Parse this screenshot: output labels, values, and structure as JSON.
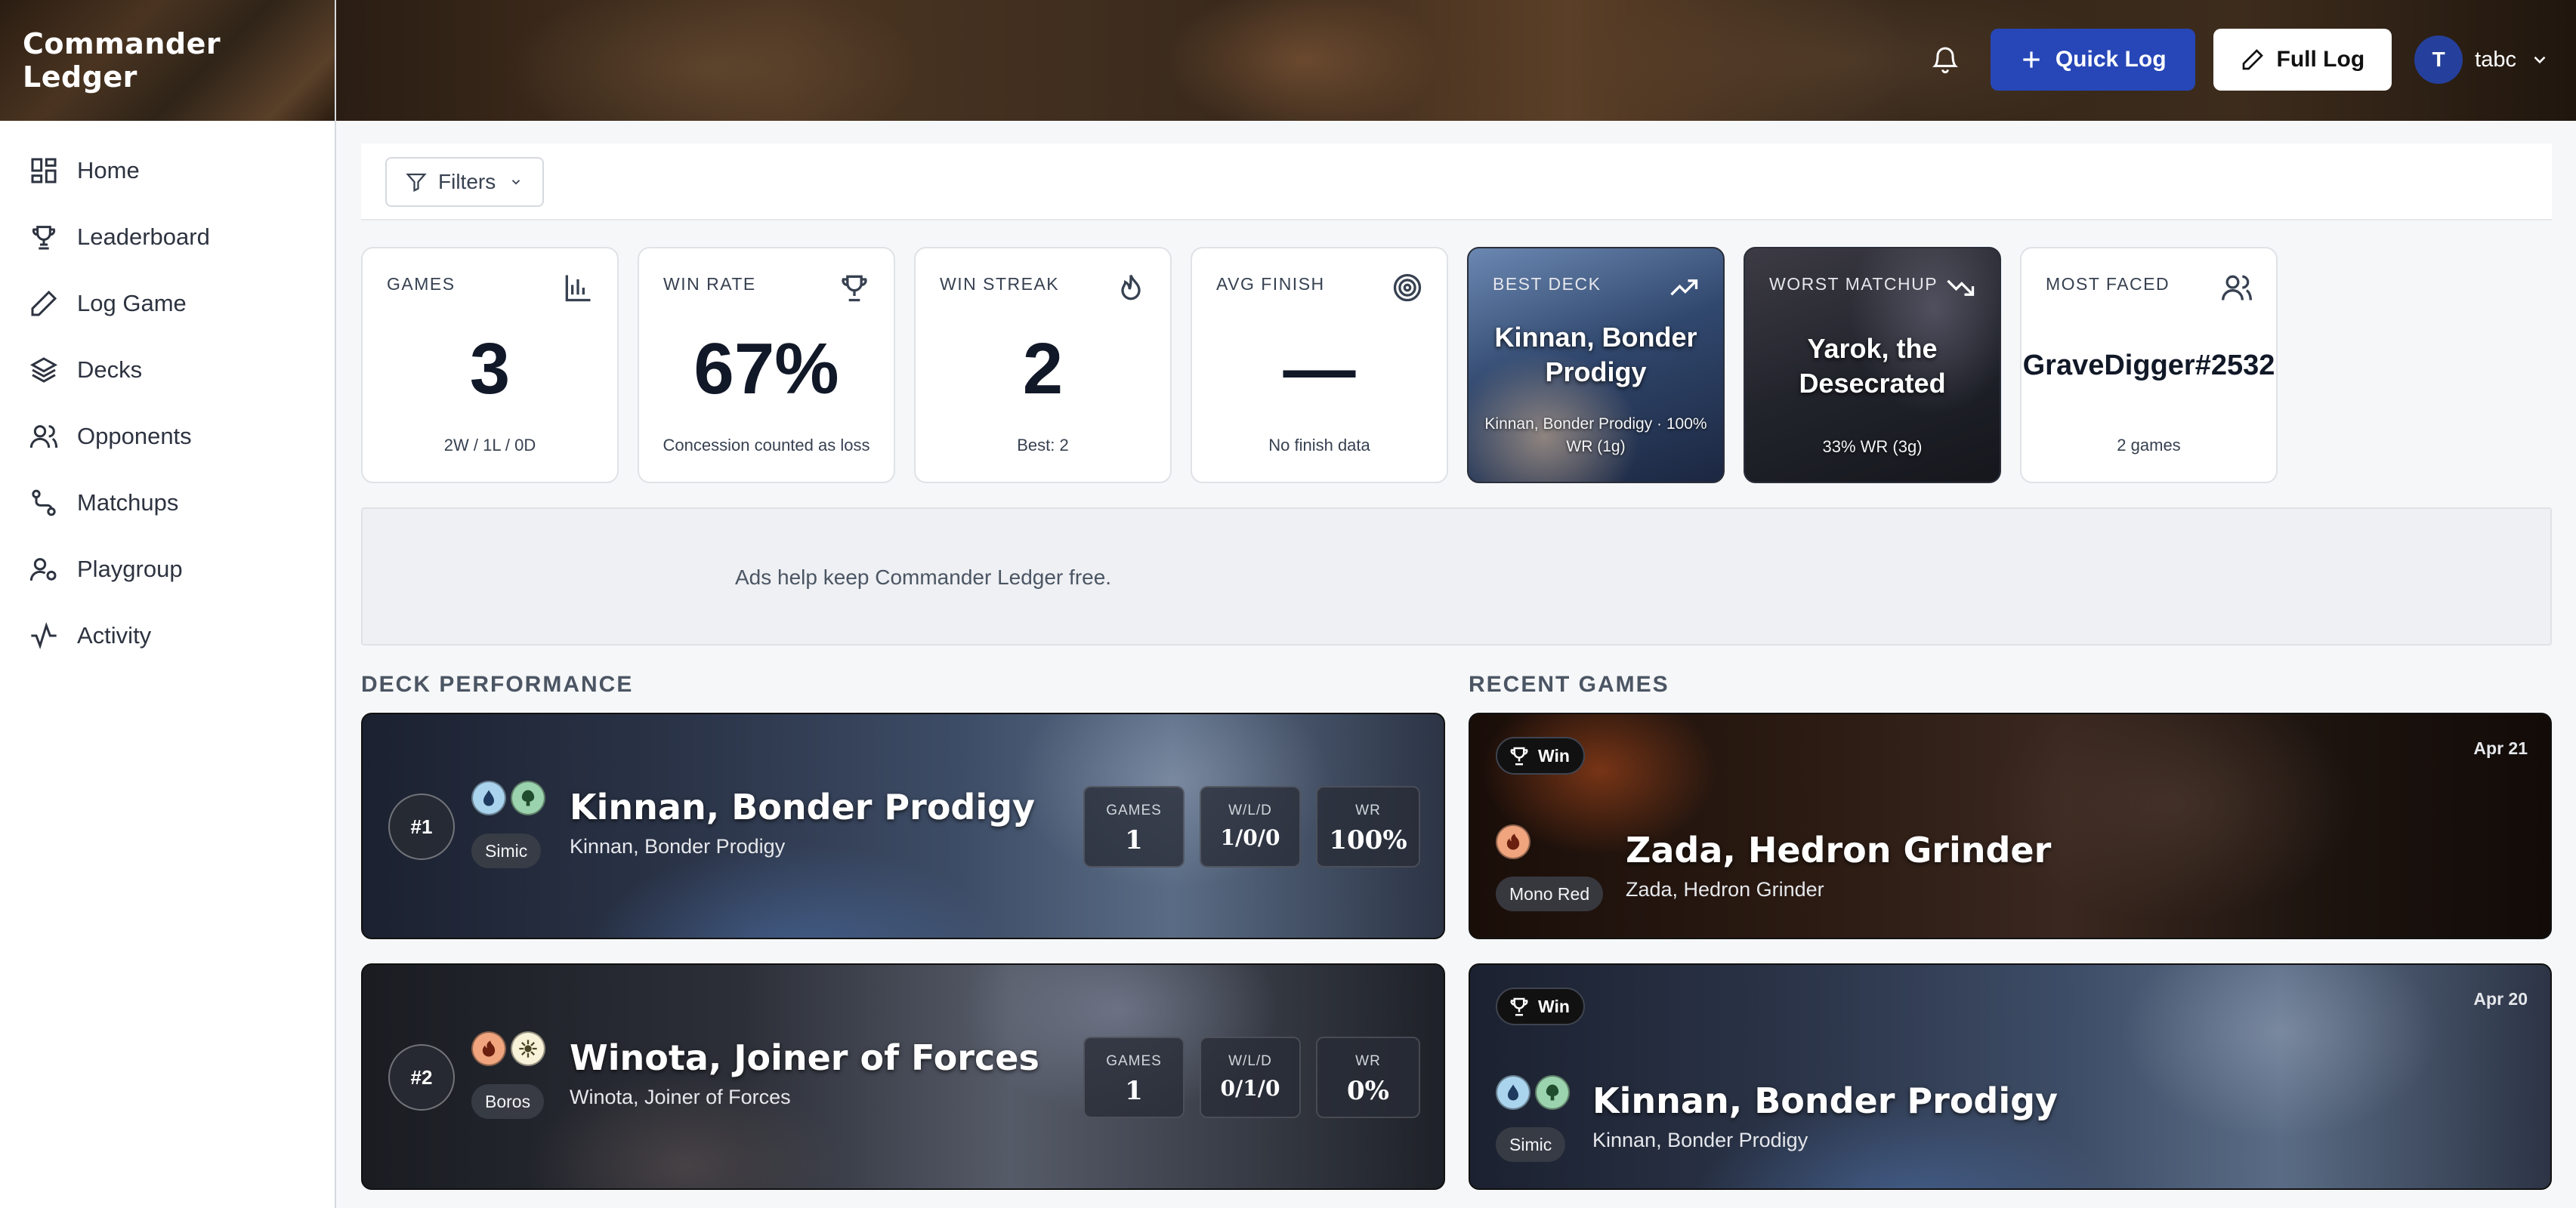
{
  "app": {
    "title": "Commander Ledger"
  },
  "sidebar": {
    "items": [
      {
        "label": "Home",
        "icon": "dashboard-icon"
      },
      {
        "label": "Leaderboard",
        "icon": "trophy-icon"
      },
      {
        "label": "Log Game",
        "icon": "pencil-icon"
      },
      {
        "label": "Decks",
        "icon": "layers-icon"
      },
      {
        "label": "Opponents",
        "icon": "users-icon"
      },
      {
        "label": "Matchups",
        "icon": "route-icon"
      },
      {
        "label": "Playgroup",
        "icon": "user-group-icon"
      },
      {
        "label": "Activity",
        "icon": "activity-icon"
      }
    ]
  },
  "header": {
    "quick_log": "Quick Log",
    "full_log": "Full Log",
    "user": {
      "initial": "T",
      "name": "tabc"
    }
  },
  "filters": {
    "label": "Filters"
  },
  "stats": {
    "games": {
      "label": "GAMES",
      "value": "3",
      "sub": "2W / 1L / 0D"
    },
    "win_rate": {
      "label": "WIN RATE",
      "value": "67%",
      "sub": "Concession counted as loss"
    },
    "win_streak": {
      "label": "WIN STREAK",
      "value": "2",
      "sub": "Best: 2"
    },
    "avg_finish": {
      "label": "AVG FINISH",
      "value": "—",
      "sub": "No finish data"
    },
    "best_deck": {
      "label": "BEST DECK",
      "name": "Kinnan, Bonder Prodigy",
      "sub": "Kinnan, Bonder Prodigy · 100% WR (1g)"
    },
    "worst_matchup": {
      "label": "WORST MATCHUP",
      "name": "Yarok, the Desecrated",
      "sub": "33% WR (3g)"
    },
    "most_faced": {
      "label": "MOST FACED",
      "name": "GraveDigger#2532",
      "sub": "2 games"
    }
  },
  "ad": {
    "text": "Ads help keep Commander Ledger free."
  },
  "deck_performance": {
    "title": "DECK PERFORMANCE",
    "decks": [
      {
        "rank": "#1",
        "name": "Kinnan, Bonder Prodigy",
        "commander": "Kinnan, Bonder Prodigy",
        "identity": "Simic",
        "colors": [
          "blue",
          "green"
        ],
        "games_label": "GAMES",
        "games": "1",
        "wld_label": "W/L/D",
        "wld": "1/0/0",
        "wr_label": "WR",
        "wr": "100%"
      },
      {
        "rank": "#2",
        "name": "Winota, Joiner of Forces",
        "commander": "Winota, Joiner of Forces",
        "identity": "Boros",
        "colors": [
          "red",
          "white"
        ],
        "games_label": "GAMES",
        "games": "1",
        "wld_label": "W/L/D",
        "wld": "0/1/0",
        "wr_label": "WR",
        "wr": "0%"
      }
    ]
  },
  "recent_games": {
    "title": "RECENT GAMES",
    "games": [
      {
        "result": "Win",
        "date": "Apr 21",
        "name": "Zada, Hedron Grinder",
        "commander": "Zada, Hedron Grinder",
        "identity": "Mono Red",
        "colors": [
          "red"
        ]
      },
      {
        "result": "Win",
        "date": "Apr 20",
        "name": "Kinnan, Bonder Prodigy",
        "commander": "Kinnan, Bonder Prodigy",
        "identity": "Simic",
        "colors": [
          "blue",
          "green"
        ]
      }
    ]
  },
  "colors": {
    "primary": "#2747b8",
    "sidebar_text": "#2d3340",
    "page_bg": "#f6f7f9"
  }
}
